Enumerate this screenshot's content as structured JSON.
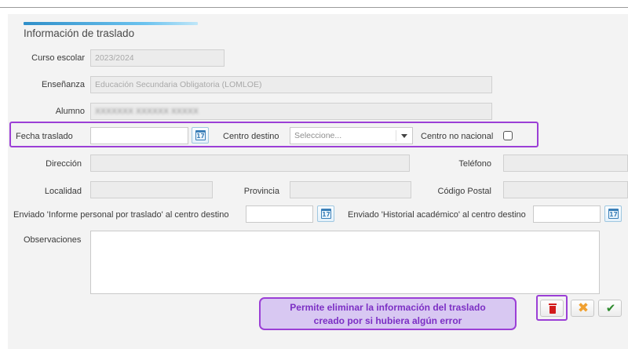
{
  "section": {
    "title": "Información de traslado"
  },
  "labels": {
    "curso_escolar": "Curso escolar",
    "ensenanza": "Enseñanza",
    "alumno": "Alumno",
    "fecha_traslado": "Fecha traslado",
    "centro_destino": "Centro destino",
    "centro_no_nacional": "Centro no nacional",
    "direccion": "Dirección",
    "telefono": "Teléfono",
    "localidad": "Localidad",
    "provincia": "Provincia",
    "codigo_postal": "Código Postal",
    "enviado_informe": "Enviado 'Informe personal por traslado' al centro destino",
    "enviado_historial": "Enviado 'Historial académico' al centro destino",
    "observaciones": "Observaciones"
  },
  "fields": {
    "curso_escolar": "2023/2024",
    "ensenanza": "Educación Secundaria Obligatoria (LOMLOE)",
    "alumno": "XXXXXXX XXXXXX XXXXX",
    "fecha_traslado": "",
    "centro_destino_placeholder": "Seleccione...",
    "direccion": "",
    "telefono": "",
    "localidad": "",
    "provincia": "",
    "codigo_postal": "",
    "observaciones": ""
  },
  "calendar_icon_text": "17",
  "tooltip": {
    "line1": "Permite eliminar la información del traslado",
    "line2": "creado por si hubiera algún error"
  },
  "icons": {
    "delete": "trash-icon",
    "cancel": "x-icon",
    "confirm": "check-icon",
    "calendar": "calendar-icon"
  },
  "buttons": {
    "cancel_glyph": "✖",
    "confirm_glyph": "✔"
  },
  "colors": {
    "highlight": "#9b3fd6",
    "tooltip_bg": "#d8c8f2",
    "delete_red": "#d21b1b",
    "cancel_orange": "#f0a030",
    "confirm_green": "#2d8a2d"
  }
}
